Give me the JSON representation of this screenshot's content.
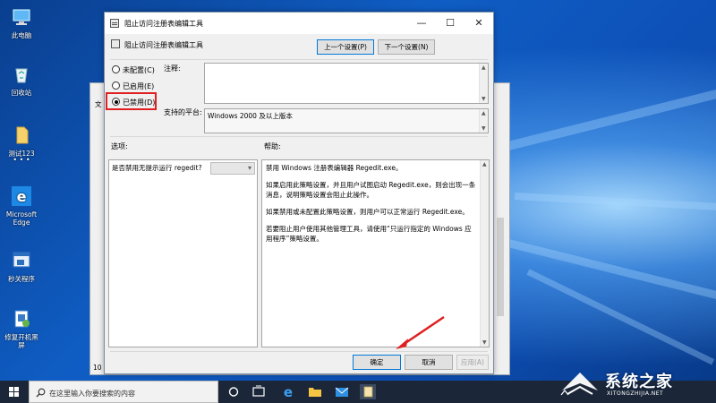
{
  "desktop": {
    "icons": [
      {
        "label": "此电脑"
      },
      {
        "label": "回收站"
      },
      {
        "label": "测试123"
      },
      {
        "label": "Microsoft Edge"
      },
      {
        "label": "秒关程序"
      },
      {
        "label": "修复开机黑屏"
      }
    ]
  },
  "background_window": {
    "tab_label": "文",
    "footer_text": "10"
  },
  "dialog": {
    "window_title": "阻止访问注册表编辑工具",
    "header_title": "阻止访问注册表编辑工具",
    "prev_button": "上一个设置(P)",
    "next_button": "下一个设置(N)",
    "radio_not_configured": "未配置(C)",
    "radio_enabled": "已启用(E)",
    "radio_disabled": "已禁用(D)",
    "selected_state": "已禁用(D)",
    "comment_label": "注释:",
    "comment_value": "",
    "supported_label": "支持的平台:",
    "supported_value": "Windows 2000 及以上版本",
    "options_label": "选项:",
    "help_label": "帮助:",
    "option_text": "是否禁用无提示运行 regedit?",
    "option_value": "",
    "help_paragraphs": [
      "禁用 Windows 注册表编辑器 Regedit.exe。",
      "如果启用此策略设置，并且用户试图启动 Regedit.exe，则会出现一条消息，说明策略设置会阻止此操作。",
      "如果禁用或未配置此策略设置，则用户可以正常运行 Regedit.exe。",
      "若要阻止用户使用其他管理工具，请使用“只运行指定的 Windows 应用程序”策略设置。"
    ],
    "ok_button": "确定",
    "cancel_button": "取消",
    "apply_button": "应用(A)"
  },
  "taskbar": {
    "search_placeholder": "在这里输入你要搜索的内容"
  },
  "watermark": {
    "title": "系统之家",
    "url": "XITONGZHIJIA.NET"
  },
  "colors": {
    "accent": "#0078d7",
    "highlight_box": "#e02020",
    "taskbar": "#1b2738"
  }
}
